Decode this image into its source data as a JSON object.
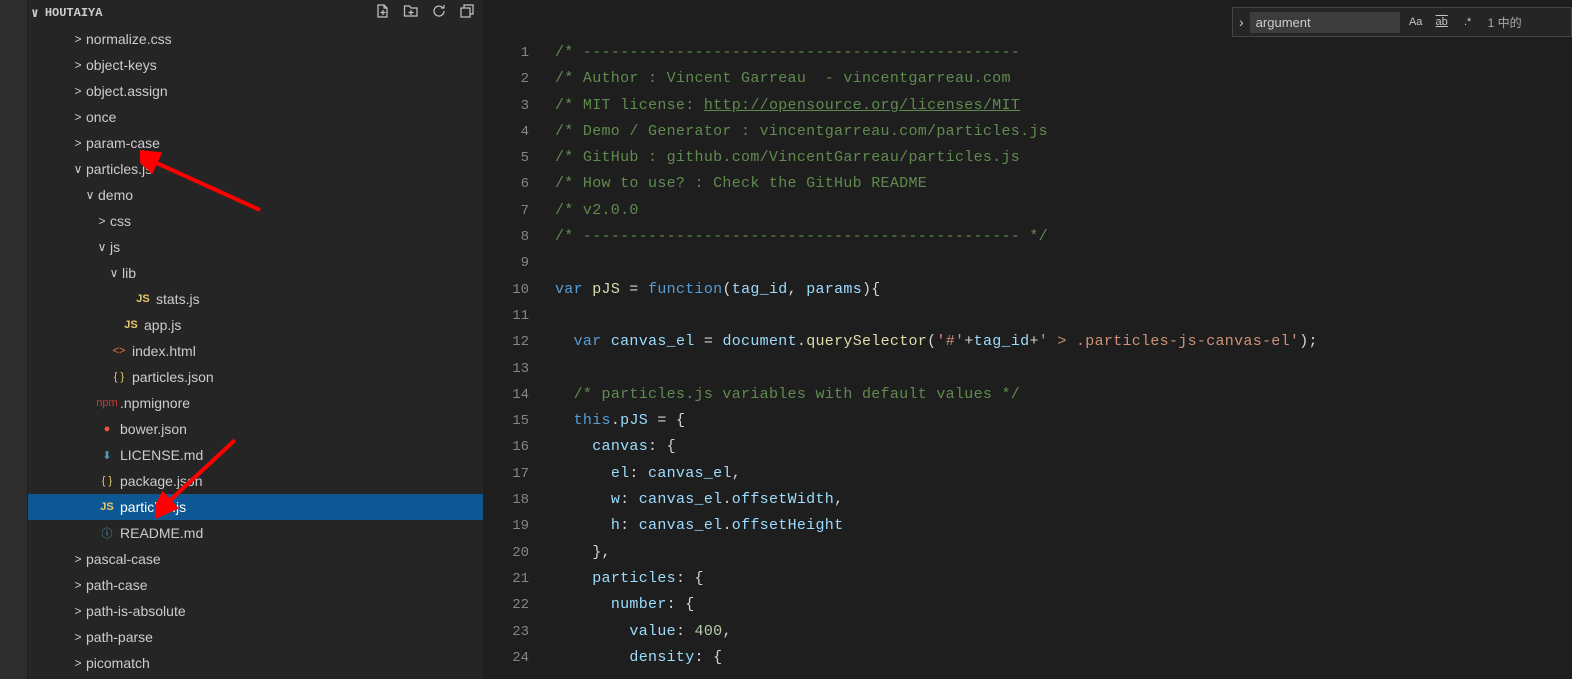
{
  "sidebar": {
    "title": "HOUTAIYA",
    "tree": [
      {
        "indent": 2,
        "chev": ">",
        "icon": "",
        "label": "normalize.css",
        "cls": ""
      },
      {
        "indent": 2,
        "chev": ">",
        "icon": "",
        "label": "object-keys",
        "cls": ""
      },
      {
        "indent": 2,
        "chev": ">",
        "icon": "",
        "label": "object.assign",
        "cls": ""
      },
      {
        "indent": 2,
        "chev": ">",
        "icon": "",
        "label": "once",
        "cls": ""
      },
      {
        "indent": 2,
        "chev": ">",
        "icon": "",
        "label": "param-case",
        "cls": ""
      },
      {
        "indent": 2,
        "chev": "∨",
        "icon": "",
        "label": "particles.js",
        "cls": ""
      },
      {
        "indent": 3,
        "chev": "∨",
        "icon": "",
        "label": "demo",
        "cls": ""
      },
      {
        "indent": 4,
        "chev": ">",
        "icon": "",
        "label": "css",
        "cls": ""
      },
      {
        "indent": 4,
        "chev": "∨",
        "icon": "",
        "label": "js",
        "cls": ""
      },
      {
        "indent": 5,
        "chev": "∨",
        "icon": "",
        "label": "lib",
        "cls": ""
      },
      {
        "indent": 6,
        "chev": "",
        "icon": "JS",
        "label": "stats.js",
        "cls": "ic-js"
      },
      {
        "indent": 5,
        "chev": "",
        "icon": "JS",
        "label": "app.js",
        "cls": "ic-js"
      },
      {
        "indent": 4,
        "chev": "",
        "icon": "<>",
        "label": "index.html",
        "cls": "ic-html"
      },
      {
        "indent": 4,
        "chev": "",
        "icon": "{ }",
        "label": "particles.json",
        "cls": "ic-json"
      },
      {
        "indent": 3,
        "chev": "",
        "icon": "npm",
        "label": ".npmignore",
        "cls": "ic-npm"
      },
      {
        "indent": 3,
        "chev": "",
        "icon": "●",
        "label": "bower.json",
        "cls": "ic-bower"
      },
      {
        "indent": 3,
        "chev": "",
        "icon": "⬇",
        "label": "LICENSE.md",
        "cls": "ic-license"
      },
      {
        "indent": 3,
        "chev": "",
        "icon": "{ }",
        "label": "package.json",
        "cls": "ic-json"
      },
      {
        "indent": 3,
        "chev": "",
        "icon": "JS",
        "label": "particles.js",
        "cls": "ic-js",
        "selected": true
      },
      {
        "indent": 3,
        "chev": "",
        "icon": "ⓘ",
        "label": "README.md",
        "cls": "ic-readme"
      },
      {
        "indent": 2,
        "chev": ">",
        "icon": "",
        "label": "pascal-case",
        "cls": ""
      },
      {
        "indent": 2,
        "chev": ">",
        "icon": "",
        "label": "path-case",
        "cls": ""
      },
      {
        "indent": 2,
        "chev": ">",
        "icon": "",
        "label": "path-is-absolute",
        "cls": ""
      },
      {
        "indent": 2,
        "chev": ">",
        "icon": "",
        "label": "path-parse",
        "cls": ""
      },
      {
        "indent": 2,
        "chev": ">",
        "icon": "",
        "label": "picomatch",
        "cls": ""
      }
    ]
  },
  "find": {
    "value": "argument",
    "result": "1 中的"
  },
  "editor": {
    "lineStart": 1,
    "lineEnd": 24,
    "lines": [
      [
        {
          "t": "/* -----------------------------------------------",
          "c": "c-comment"
        }
      ],
      [
        {
          "t": "/* Author : Vincent Garreau  - vincentgarreau.com",
          "c": "c-comment"
        }
      ],
      [
        {
          "t": "/* MIT license: ",
          "c": "c-comment"
        },
        {
          "t": "http://opensource.org/licenses/MIT",
          "c": "c-link"
        }
      ],
      [
        {
          "t": "/* Demo / Generator : vincentgarreau.com/particles.js",
          "c": "c-comment"
        }
      ],
      [
        {
          "t": "/* GitHub : github.com/VincentGarreau/particles.js",
          "c": "c-comment"
        }
      ],
      [
        {
          "t": "/* How to use? : Check the GitHub README",
          "c": "c-comment"
        }
      ],
      [
        {
          "t": "/* v2.0.0",
          "c": "c-comment"
        }
      ],
      [
        {
          "t": "/* ----------------------------------------------- */",
          "c": "c-comment"
        }
      ],
      [
        {
          "t": "",
          "c": ""
        }
      ],
      [
        {
          "t": "var ",
          "c": "c-keyword"
        },
        {
          "t": "pJS",
          "c": "c-func"
        },
        {
          "t": " = ",
          "c": "c-punct"
        },
        {
          "t": "function",
          "c": "c-keyword"
        },
        {
          "t": "(",
          "c": "c-punct"
        },
        {
          "t": "tag_id",
          "c": "c-var"
        },
        {
          "t": ", ",
          "c": "c-punct"
        },
        {
          "t": "params",
          "c": "c-var"
        },
        {
          "t": "){",
          "c": "c-punct"
        }
      ],
      [
        {
          "t": "",
          "c": ""
        }
      ],
      [
        {
          "t": "  ",
          "c": ""
        },
        {
          "t": "var ",
          "c": "c-keyword"
        },
        {
          "t": "canvas_el",
          "c": "c-var"
        },
        {
          "t": " = ",
          "c": "c-punct"
        },
        {
          "t": "document",
          "c": "c-var"
        },
        {
          "t": ".",
          "c": "c-punct"
        },
        {
          "t": "querySelector",
          "c": "c-func"
        },
        {
          "t": "(",
          "c": "c-punct"
        },
        {
          "t": "'#'",
          "c": "c-string"
        },
        {
          "t": "+",
          "c": "c-punct"
        },
        {
          "t": "tag_id",
          "c": "c-var"
        },
        {
          "t": "+",
          "c": "c-punct"
        },
        {
          "t": "' > .particles-js-canvas-el'",
          "c": "c-string"
        },
        {
          "t": ");",
          "c": "c-punct"
        }
      ],
      [
        {
          "t": "",
          "c": ""
        }
      ],
      [
        {
          "t": "  ",
          "c": ""
        },
        {
          "t": "/* particles.js variables with default values */",
          "c": "c-comment"
        }
      ],
      [
        {
          "t": "  ",
          "c": ""
        },
        {
          "t": "this",
          "c": "c-keyword"
        },
        {
          "t": ".",
          "c": "c-punct"
        },
        {
          "t": "pJS",
          "c": "c-var"
        },
        {
          "t": " = {",
          "c": "c-punct"
        }
      ],
      [
        {
          "t": "    ",
          "c": ""
        },
        {
          "t": "canvas",
          "c": "c-var"
        },
        {
          "t": ": {",
          "c": "c-punct"
        }
      ],
      [
        {
          "t": "      ",
          "c": ""
        },
        {
          "t": "el",
          "c": "c-var"
        },
        {
          "t": ": ",
          "c": "c-punct"
        },
        {
          "t": "canvas_el",
          "c": "c-var"
        },
        {
          "t": ",",
          "c": "c-punct"
        }
      ],
      [
        {
          "t": "      ",
          "c": ""
        },
        {
          "t": "w",
          "c": "c-var"
        },
        {
          "t": ": ",
          "c": "c-punct"
        },
        {
          "t": "canvas_el",
          "c": "c-var"
        },
        {
          "t": ".",
          "c": "c-punct"
        },
        {
          "t": "offsetWidth",
          "c": "c-var"
        },
        {
          "t": ",",
          "c": "c-punct"
        }
      ],
      [
        {
          "t": "      ",
          "c": ""
        },
        {
          "t": "h",
          "c": "c-var"
        },
        {
          "t": ": ",
          "c": "c-punct"
        },
        {
          "t": "canvas_el",
          "c": "c-var"
        },
        {
          "t": ".",
          "c": "c-punct"
        },
        {
          "t": "offsetHeight",
          "c": "c-var"
        }
      ],
      [
        {
          "t": "    },",
          "c": "c-punct"
        }
      ],
      [
        {
          "t": "    ",
          "c": ""
        },
        {
          "t": "particles",
          "c": "c-var"
        },
        {
          "t": ": {",
          "c": "c-punct"
        }
      ],
      [
        {
          "t": "      ",
          "c": ""
        },
        {
          "t": "number",
          "c": "c-var"
        },
        {
          "t": ": {",
          "c": "c-punct"
        }
      ],
      [
        {
          "t": "        ",
          "c": ""
        },
        {
          "t": "value",
          "c": "c-var"
        },
        {
          "t": ": ",
          "c": "c-punct"
        },
        {
          "t": "400",
          "c": "c-num"
        },
        {
          "t": ",",
          "c": "c-punct"
        }
      ],
      [
        {
          "t": "        ",
          "c": ""
        },
        {
          "t": "density",
          "c": "c-var"
        },
        {
          "t": ": {",
          "c": "c-punct"
        }
      ]
    ]
  }
}
